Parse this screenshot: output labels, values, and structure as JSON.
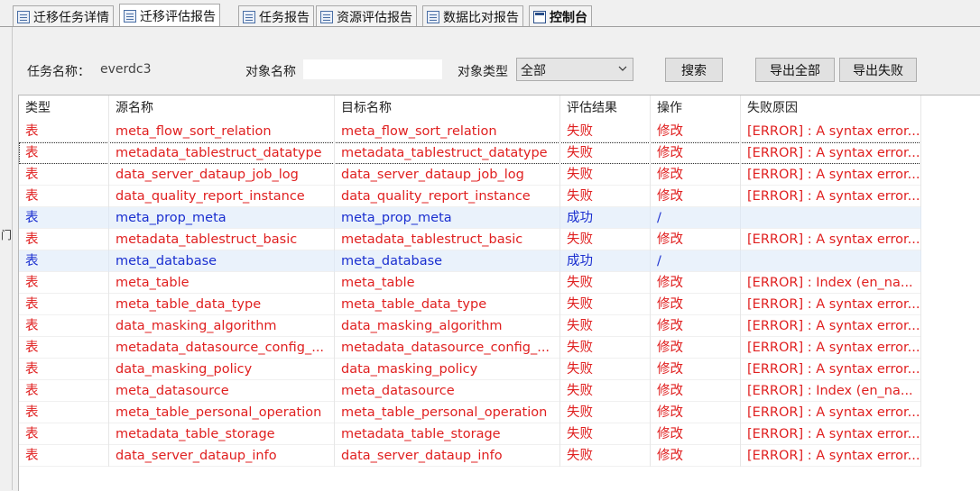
{
  "tabs": [
    {
      "label": "迁移任务详情",
      "icon": "list-icon",
      "active": false
    },
    {
      "label": "迁移评估报告",
      "icon": "report-icon",
      "active": true
    },
    {
      "label": "任务报告",
      "icon": "report-icon",
      "active": false
    },
    {
      "label": "资源评估报告",
      "icon": "report-icon",
      "active": false
    },
    {
      "label": "数据比对报告",
      "icon": "report-icon",
      "active": false
    },
    {
      "label": "控制台",
      "icon": "console-icon",
      "active": false
    }
  ],
  "toolbar": {
    "task_name_label": "任务名称：",
    "task_name_value": "everdc3",
    "object_name_label": "对象名称",
    "object_name_value": "",
    "object_type_label": "对象类型",
    "object_type_value": "全部",
    "search_label": "搜索",
    "export_all_label": "导出全部",
    "export_fail_label": "导出失败"
  },
  "table": {
    "columns": [
      "类型",
      "源名称",
      "目标名称",
      "评估结果",
      "操作",
      "失败原因"
    ],
    "rows": [
      [
        "表",
        "meta_flow_sort_relation",
        "meta_flow_sort_relation",
        "失败",
        "修改",
        "[ERROR] : A syntax error..."
      ],
      [
        "表",
        "metadata_tablestruct_datatype",
        "metadata_tablestruct_datatype",
        "失败",
        "修改",
        "[ERROR] : A syntax error..."
      ],
      [
        "表",
        "data_server_dataup_job_log",
        "data_server_dataup_job_log",
        "失败",
        "修改",
        "[ERROR] : A syntax error..."
      ],
      [
        "表",
        "data_quality_report_instance",
        "data_quality_report_instance",
        "失败",
        "修改",
        "[ERROR] : A syntax error..."
      ],
      [
        "表",
        "meta_prop_meta",
        "meta_prop_meta",
        "成功",
        "/",
        ""
      ],
      [
        "表",
        "metadata_tablestruct_basic",
        "metadata_tablestruct_basic",
        "失败",
        "修改",
        "[ERROR] : A syntax error..."
      ],
      [
        "表",
        "meta_database",
        "meta_database",
        "成功",
        "/",
        ""
      ],
      [
        "表",
        "meta_table",
        "meta_table",
        "失败",
        "修改",
        "[ERROR] : Index (en_na..."
      ],
      [
        "表",
        "meta_table_data_type",
        "meta_table_data_type",
        "失败",
        "修改",
        "[ERROR] : A syntax error..."
      ],
      [
        "表",
        "data_masking_algorithm",
        "data_masking_algorithm",
        "失败",
        "修改",
        "[ERROR] : A syntax error..."
      ],
      [
        "表",
        "metadata_datasource_config_...",
        "metadata_datasource_config_...",
        "失败",
        "修改",
        "[ERROR] : A syntax error..."
      ],
      [
        "表",
        "data_masking_policy",
        "data_masking_policy",
        "失败",
        "修改",
        "[ERROR] : A syntax error..."
      ],
      [
        "表",
        "meta_datasource",
        "meta_datasource",
        "失败",
        "修改",
        "[ERROR] : Index (en_na..."
      ],
      [
        "表",
        "meta_table_personal_operation",
        "meta_table_personal_operation",
        "失败",
        "修改",
        "[ERROR] : A syntax error..."
      ],
      [
        "表",
        "metadata_table_storage",
        "metadata_table_storage",
        "失败",
        "修改",
        "[ERROR] : A syntax error..."
      ],
      [
        "表",
        "data_server_dataup_info",
        "data_server_dataup_info",
        "失败",
        "修改",
        "[ERROR] : A syntax error..."
      ]
    ]
  },
  "left_strip_glyph": "门",
  "colors": {
    "fail": "#e02020",
    "success": "#1a2fd0",
    "selected_row_bg": "#eaf2fb"
  }
}
